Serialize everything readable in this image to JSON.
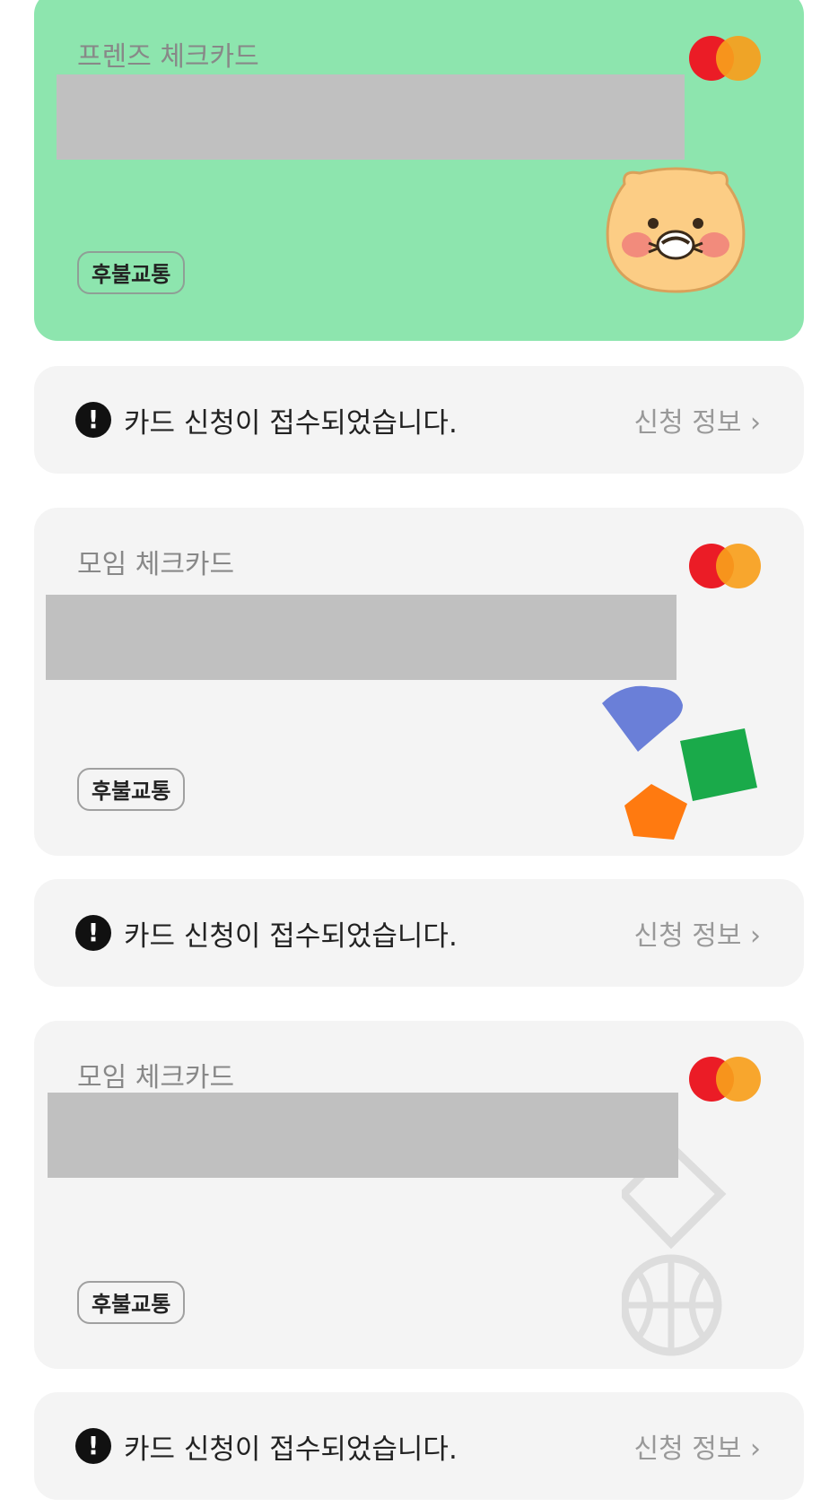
{
  "cards": [
    {
      "title": "프렌즈 체크카드",
      "badge": "후불교통",
      "brand_icon": "mastercard-icon",
      "illustration": "friends-character-icon",
      "background": "#8de5ae"
    },
    {
      "title": "모임 체크카드",
      "badge": "후불교통",
      "brand_icon": "mastercard-icon",
      "illustration": "colorful-shapes-icon",
      "background": "#f4f4f4"
    },
    {
      "title": "모임 체크카드",
      "badge": "후불교통",
      "brand_icon": "mastercard-icon",
      "illustration": "basketball-diamond-icon",
      "background": "#f4f4f4"
    }
  ],
  "notices": [
    {
      "message": "카드 신청이 접수되었습니다.",
      "link": "신청 정보 ›"
    },
    {
      "message": "카드 신청이 접수되었습니다.",
      "link": "신청 정보 ›"
    },
    {
      "message": "카드 신청이 접수되었습니다.",
      "link": "신청 정보 ›"
    }
  ],
  "icons": {
    "alert": "exclamation-icon",
    "chevron": "chevron-right-icon"
  },
  "colors": {
    "mastercard_red": "#eb1c26",
    "mastercard_orange": "#f79e1b",
    "redaction": "#c0c0c0"
  }
}
